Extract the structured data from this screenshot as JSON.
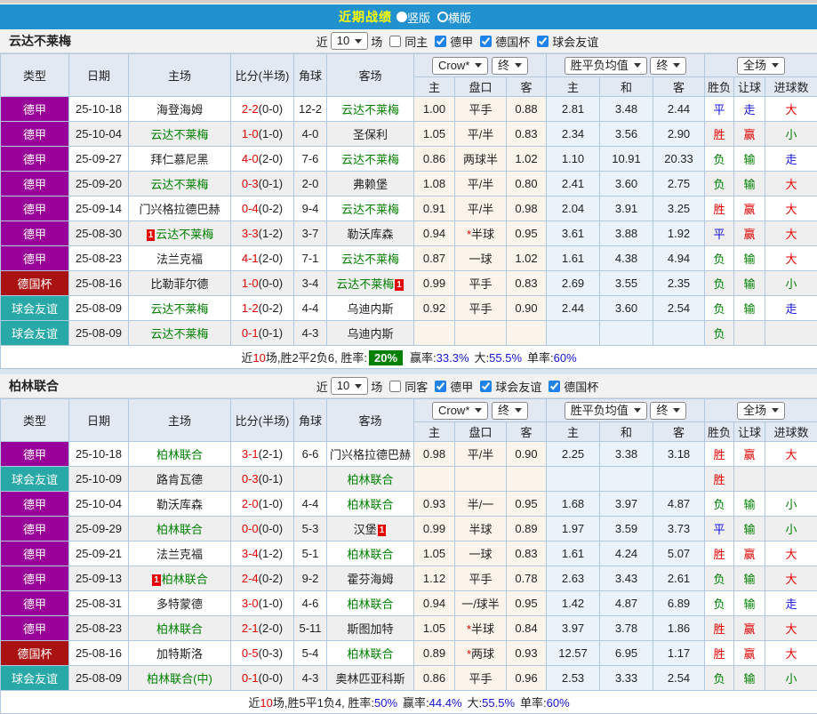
{
  "window": {
    "title": "近期战绩",
    "titlebar_bg": "#2191D0",
    "title_color": "#FFFF00",
    "view_options": [
      {
        "label": "竖版",
        "selected": true
      },
      {
        "label": "横版",
        "selected": false
      }
    ]
  },
  "colors": {
    "type_badge": {
      "德甲": "#990099",
      "德国杯": "#AA1111",
      "球会友谊": "#29A8A8"
    },
    "result": {
      "胜": "#E60000",
      "赢": "#E60000",
      "大": "#E60000",
      "平": "#1414E0",
      "走": "#1414E0",
      "负": "#008000",
      "输": "#008000",
      "小": "#008000"
    },
    "team_green": "#008000",
    "score_red": "#E60000",
    "rate_badge_bg": "#008000",
    "value_blue": "#1414D8"
  },
  "table_header": {
    "cols": [
      "类型",
      "日期",
      "主场",
      "比分(半场)",
      "角球",
      "客场"
    ],
    "selects": {
      "odds_source": "Crow*",
      "final1": "终",
      "avg": "胜平负均值",
      "final2": "终",
      "scope": "全场"
    },
    "subcols": [
      "主",
      "盘口",
      "客",
      "主",
      "和",
      "客",
      "胜负",
      "让球",
      "进球数"
    ]
  },
  "sections": [
    {
      "team": "云达不莱梅",
      "filter": {
        "near": "近",
        "count": "10",
        "games": "场",
        "same": "同主",
        "same_checked": false,
        "leagues": [
          "德甲",
          "德国杯",
          "球会友谊"
        ]
      },
      "rows": [
        {
          "type": "德甲",
          "date": "25-10-18",
          "home": {
            "name": "海登海姆"
          },
          "score": "2-2",
          "half": "(0-0)",
          "corners": "12-2",
          "away": {
            "name": "云达不莱梅",
            "green": true
          },
          "odds": [
            "1.00",
            "平手",
            "0.88"
          ],
          "avg": [
            "2.81",
            "3.48",
            "2.44"
          ],
          "results": [
            "平",
            "走",
            "大"
          ]
        },
        {
          "type": "德甲",
          "date": "25-10-04",
          "home": {
            "name": "云达不莱梅",
            "green": true
          },
          "score": "1-0",
          "half": "(1-0)",
          "corners": "4-0",
          "away": {
            "name": "圣保利"
          },
          "odds": [
            "1.05",
            "平/半",
            "0.83"
          ],
          "avg": [
            "2.34",
            "3.56",
            "2.90"
          ],
          "results": [
            "胜",
            "赢",
            "小"
          ]
        },
        {
          "type": "德甲",
          "date": "25-09-27",
          "home": {
            "name": "拜仁慕尼黑"
          },
          "score": "4-0",
          "half": "(2-0)",
          "corners": "7-6",
          "away": {
            "name": "云达不莱梅",
            "green": true
          },
          "odds": [
            "0.86",
            "两球半",
            "1.02"
          ],
          "avg": [
            "1.10",
            "10.91",
            "20.33"
          ],
          "results": [
            "负",
            "输",
            "走"
          ]
        },
        {
          "type": "德甲",
          "date": "25-09-20",
          "home": {
            "name": "云达不莱梅",
            "green": true
          },
          "score": "0-3",
          "half": "(0-1)",
          "corners": "2-0",
          "away": {
            "name": "弗赖堡"
          },
          "odds": [
            "1.08",
            "平/半",
            "0.80"
          ],
          "avg": [
            "2.41",
            "3.60",
            "2.75"
          ],
          "results": [
            "负",
            "输",
            "大"
          ]
        },
        {
          "type": "德甲",
          "date": "25-09-14",
          "home": {
            "name": "门兴格拉德巴赫"
          },
          "score": "0-4",
          "half": "(0-2)",
          "corners": "9-4",
          "away": {
            "name": "云达不莱梅",
            "green": true
          },
          "odds": [
            "0.91",
            "平/半",
            "0.98"
          ],
          "avg": [
            "2.04",
            "3.91",
            "3.25"
          ],
          "results": [
            "胜",
            "赢",
            "大"
          ]
        },
        {
          "type": "德甲",
          "date": "25-08-30",
          "home": {
            "name": "云达不莱梅",
            "green": true,
            "badge": "1",
            "badge_pos": "before"
          },
          "score": "3-3",
          "half": "(1-2)",
          "corners": "3-7",
          "away": {
            "name": "勒沃库森"
          },
          "odds": [
            "0.94",
            "*半球",
            "0.95"
          ],
          "avg": [
            "3.61",
            "3.88",
            "1.92"
          ],
          "results": [
            "平",
            "赢",
            "大"
          ]
        },
        {
          "type": "德甲",
          "date": "25-08-23",
          "home": {
            "name": "法兰克福"
          },
          "score": "4-1",
          "half": "(2-0)",
          "corners": "7-1",
          "away": {
            "name": "云达不莱梅",
            "green": true
          },
          "odds": [
            "0.87",
            "一球",
            "1.02"
          ],
          "avg": [
            "1.61",
            "4.38",
            "4.94"
          ],
          "results": [
            "负",
            "输",
            "大"
          ]
        },
        {
          "type": "德国杯",
          "date": "25-08-16",
          "home": {
            "name": "比勒菲尔德"
          },
          "score": "1-0",
          "half": "(0-0)",
          "corners": "3-4",
          "away": {
            "name": "云达不莱梅",
            "green": true,
            "badge": "1",
            "badge_pos": "after"
          },
          "odds": [
            "0.99",
            "平手",
            "0.83"
          ],
          "avg": [
            "2.69",
            "3.55",
            "2.35"
          ],
          "results": [
            "负",
            "输",
            "小"
          ]
        },
        {
          "type": "球会友谊",
          "date": "25-08-09",
          "home": {
            "name": "云达不莱梅",
            "green": true
          },
          "score": "1-2",
          "half": "(0-2)",
          "corners": "4-4",
          "away": {
            "name": "乌迪内斯"
          },
          "odds": [
            "0.92",
            "平手",
            "0.90"
          ],
          "avg": [
            "2.44",
            "3.60",
            "2.54"
          ],
          "results": [
            "负",
            "输",
            "走"
          ]
        },
        {
          "type": "球会友谊",
          "date": "25-08-09",
          "home": {
            "name": "云达不莱梅",
            "green": true
          },
          "score": "0-1",
          "half": "(0-1)",
          "corners": "4-3",
          "away": {
            "name": "乌迪内斯"
          },
          "odds": [
            "",
            "",
            ""
          ],
          "avg": [
            "",
            "",
            ""
          ],
          "results": [
            "负",
            "",
            ""
          ]
        }
      ],
      "summary": {
        "near": "近",
        "count": "10",
        "text": "场,胜2平2负6, 胜率:",
        "rate": "20%",
        "rate_badged": true,
        "stats": [
          [
            "赢率:",
            "33.3%"
          ],
          [
            "大:",
            "55.5%"
          ],
          [
            "单率:",
            "60%"
          ]
        ]
      }
    },
    {
      "team": "柏林联合",
      "filter": {
        "near": "近",
        "count": "10",
        "games": "场",
        "same": "同客",
        "same_checked": false,
        "leagues": [
          "德甲",
          "球会友谊",
          "德国杯"
        ]
      },
      "rows": [
        {
          "type": "德甲",
          "date": "25-10-18",
          "home": {
            "name": "柏林联合",
            "green": true
          },
          "score": "3-1",
          "half": "(2-1)",
          "corners": "6-6",
          "away": {
            "name": "门兴格拉德巴赫"
          },
          "odds": [
            "0.98",
            "平/半",
            "0.90"
          ],
          "avg": [
            "2.25",
            "3.38",
            "3.18"
          ],
          "results": [
            "胜",
            "赢",
            "大"
          ]
        },
        {
          "type": "球会友谊",
          "date": "25-10-09",
          "home": {
            "name": "路肯瓦德"
          },
          "score": "0-3",
          "half": "(0-1)",
          "corners": "",
          "away": {
            "name": "柏林联合",
            "green": true
          },
          "odds": [
            "",
            "",
            ""
          ],
          "avg": [
            "",
            "",
            ""
          ],
          "results": [
            "胜",
            "",
            ""
          ]
        },
        {
          "type": "德甲",
          "date": "25-10-04",
          "home": {
            "name": "勒沃库森"
          },
          "score": "2-0",
          "half": "(1-0)",
          "corners": "4-4",
          "away": {
            "name": "柏林联合",
            "green": true
          },
          "odds": [
            "0.93",
            "半/一",
            "0.95"
          ],
          "avg": [
            "1.68",
            "3.97",
            "4.87"
          ],
          "results": [
            "负",
            "输",
            "小"
          ]
        },
        {
          "type": "德甲",
          "date": "25-09-29",
          "home": {
            "name": "柏林联合",
            "green": true
          },
          "score": "0-0",
          "half": "(0-0)",
          "corners": "5-3",
          "away": {
            "name": "汉堡",
            "badge": "1",
            "badge_pos": "after"
          },
          "odds": [
            "0.99",
            "半球",
            "0.89"
          ],
          "avg": [
            "1.97",
            "3.59",
            "3.73"
          ],
          "results": [
            "平",
            "输",
            "小"
          ]
        },
        {
          "type": "德甲",
          "date": "25-09-21",
          "home": {
            "name": "法兰克福"
          },
          "score": "3-4",
          "half": "(1-2)",
          "corners": "5-1",
          "away": {
            "name": "柏林联合",
            "green": true
          },
          "odds": [
            "1.05",
            "一球",
            "0.83"
          ],
          "avg": [
            "1.61",
            "4.24",
            "5.07"
          ],
          "results": [
            "胜",
            "赢",
            "大"
          ]
        },
        {
          "type": "德甲",
          "date": "25-09-13",
          "home": {
            "name": "柏林联合",
            "green": true,
            "badge": "1",
            "badge_pos": "before"
          },
          "score": "2-4",
          "half": "(0-2)",
          "corners": "9-2",
          "away": {
            "name": "霍芬海姆"
          },
          "odds": [
            "1.12",
            "平手",
            "0.78"
          ],
          "avg": [
            "2.63",
            "3.43",
            "2.61"
          ],
          "results": [
            "负",
            "输",
            "大"
          ]
        },
        {
          "type": "德甲",
          "date": "25-08-31",
          "home": {
            "name": "多特蒙德"
          },
          "score": "3-0",
          "half": "(1-0)",
          "corners": "4-6",
          "away": {
            "name": "柏林联合",
            "green": true
          },
          "odds": [
            "0.94",
            "一/球半",
            "0.95"
          ],
          "avg": [
            "1.42",
            "4.87",
            "6.89"
          ],
          "results": [
            "负",
            "输",
            "走"
          ]
        },
        {
          "type": "德甲",
          "date": "25-08-23",
          "home": {
            "name": "柏林联合",
            "green": true
          },
          "score": "2-1",
          "half": "(2-0)",
          "corners": "5-11",
          "away": {
            "name": "斯图加特"
          },
          "odds": [
            "1.05",
            "*半球",
            "0.84"
          ],
          "avg": [
            "3.97",
            "3.78",
            "1.86"
          ],
          "results": [
            "胜",
            "赢",
            "大"
          ]
        },
        {
          "type": "德国杯",
          "date": "25-08-16",
          "home": {
            "name": "加特斯洛"
          },
          "score": "0-5",
          "half": "(0-3)",
          "corners": "5-4",
          "away": {
            "name": "柏林联合",
            "green": true
          },
          "odds": [
            "0.89",
            "*两球",
            "0.93"
          ],
          "avg": [
            "12.57",
            "6.95",
            "1.17"
          ],
          "results": [
            "胜",
            "赢",
            "大"
          ]
        },
        {
          "type": "球会友谊",
          "date": "25-08-09",
          "home": {
            "name": "柏林联合(中)",
            "green": true
          },
          "score": "0-1",
          "half": "(0-0)",
          "corners": "4-3",
          "away": {
            "name": "奥林匹亚科斯"
          },
          "odds": [
            "0.86",
            "平手",
            "0.96"
          ],
          "avg": [
            "2.53",
            "3.33",
            "2.54"
          ],
          "results": [
            "负",
            "输",
            "小"
          ]
        }
      ],
      "summary": {
        "near": "近",
        "count": "10",
        "text": "场,胜5平1负4, 胜率:",
        "rate": "50%",
        "rate_badged": false,
        "stats": [
          [
            "赢率:",
            "44.4%"
          ],
          [
            "大:",
            "55.5%"
          ],
          [
            "单率:",
            "60%"
          ]
        ]
      }
    }
  ]
}
